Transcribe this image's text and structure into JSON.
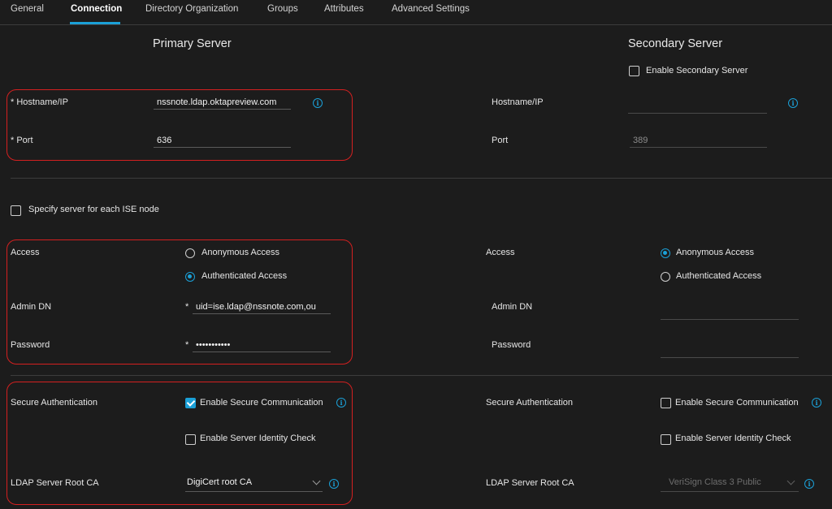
{
  "tabs": [
    {
      "label": "General"
    },
    {
      "label": "Connection"
    },
    {
      "label": "Directory Organization"
    },
    {
      "label": "Groups"
    },
    {
      "label": "Attributes"
    },
    {
      "label": "Advanced Settings"
    }
  ],
  "active_tab": "Connection",
  "primary": {
    "heading": "Primary Server",
    "hostname_label": "* Hostname/IP",
    "hostname_value": "nssnote.ldap.oktapreview.com",
    "port_label": "* Port",
    "port_value": "636",
    "access_label": "Access",
    "anonymous_label": "Anonymous Access",
    "authenticated_label": "Authenticated Access",
    "selected_access": "Authenticated Access",
    "admin_dn_label": "Admin DN",
    "admin_dn_value": "uid=ise.ldap@nssnote.com,ou",
    "password_label": "Password",
    "password_value": "•••••••••••",
    "required_mark": "*",
    "secure_auth_label": "Secure Authentication",
    "enable_secure_label": "Enable Secure Communication",
    "enable_secure_checked": true,
    "identity_check_label": "Enable Server Identity Check",
    "identity_check_checked": false,
    "root_ca_label": "LDAP Server Root CA",
    "root_ca_value": "DigiCert root CA"
  },
  "secondary": {
    "heading": "Secondary Server",
    "enable_label": "Enable Secondary Server",
    "enable_checked": false,
    "hostname_label": "Hostname/IP",
    "hostname_value": "",
    "port_label": "Port",
    "port_value": "389",
    "access_label": "Access",
    "anonymous_label": "Anonymous Access",
    "authenticated_label": "Authenticated Access",
    "selected_access": "Anonymous Access",
    "admin_dn_label": "Admin DN",
    "admin_dn_value": "",
    "password_label": "Password",
    "password_value": "",
    "secure_auth_label": "Secure Authentication",
    "enable_secure_label": "Enable Secure Communication",
    "enable_secure_checked": false,
    "identity_check_label": "Enable Server Identity Check",
    "identity_check_checked": false,
    "root_ca_label": "LDAP Server Root CA",
    "root_ca_value": "VeriSign Class 3 Public"
  },
  "specify_server_label": "Specify server for each ISE node",
  "specify_server_checked": false,
  "colors": {
    "accent": "#1ba0d7",
    "highlight": "#d42020",
    "background": "#1c1c1c"
  }
}
